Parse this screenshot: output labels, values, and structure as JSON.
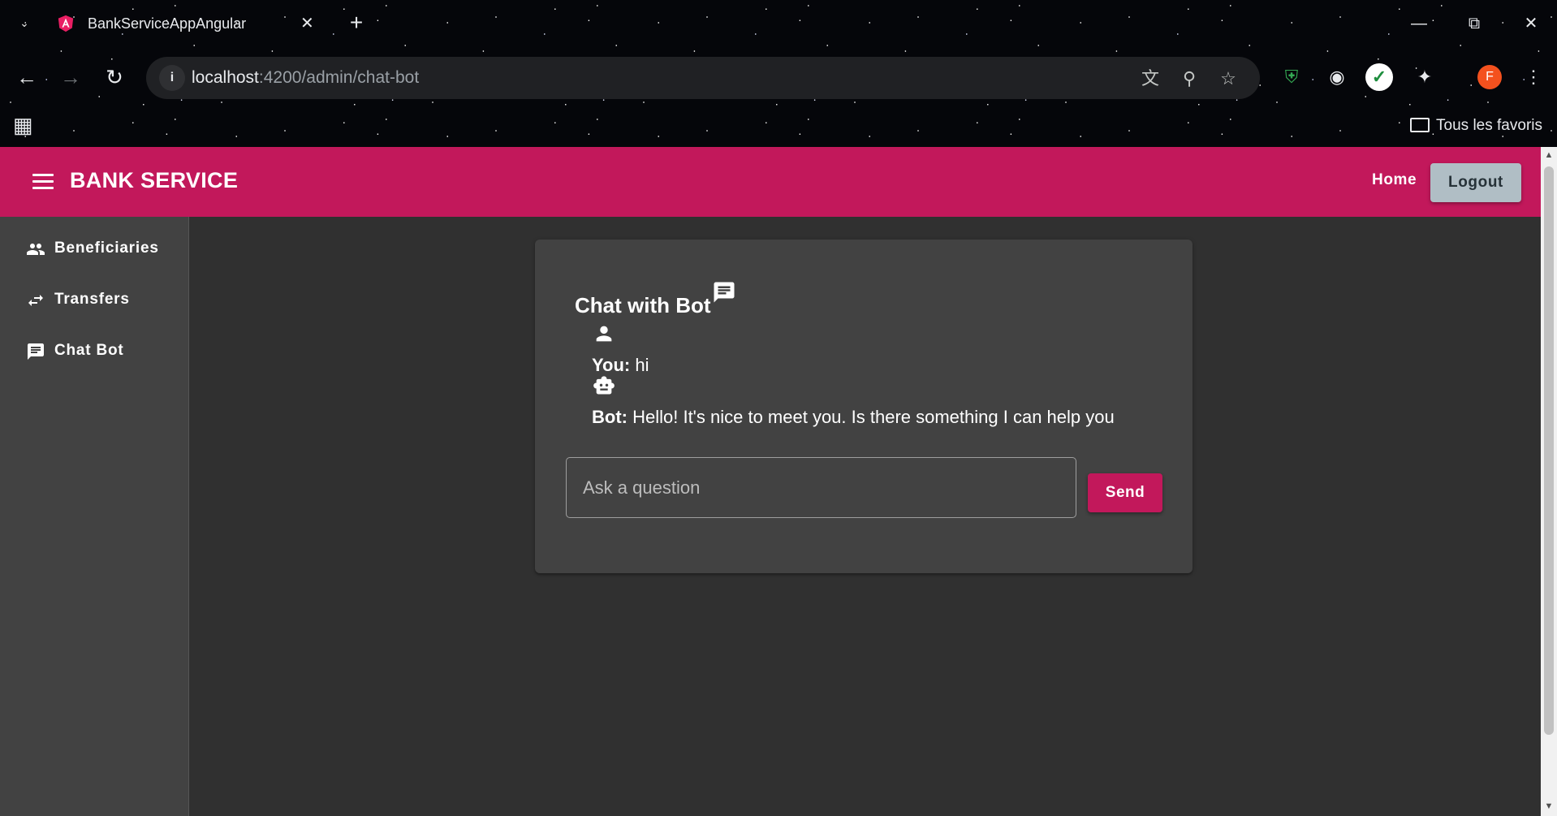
{
  "browser": {
    "tab_title": "BankServiceAppAngular",
    "url_host": "localhost",
    "url_path": ":4200/admin/chat-bot",
    "bookmarks_folder": "Tous les favoris",
    "profile_initial": "F"
  },
  "app": {
    "brand": "BANK SERVICE",
    "home_label": "Home",
    "logout_label": "Logout",
    "accent_color": "#c2185b"
  },
  "sidebar": {
    "items": [
      {
        "label": "Beneficiaries",
        "icon": "people-icon"
      },
      {
        "label": "Transfers",
        "icon": "swap-arrows-icon"
      },
      {
        "label": "Chat Bot",
        "icon": "chat-icon"
      }
    ]
  },
  "chat": {
    "title": "Chat with Bot",
    "messages": [
      {
        "sender": "You:",
        "text": " hi",
        "icon": "person-icon"
      },
      {
        "sender": "Bot:",
        "text": " Hello! It's nice to meet you. Is there something I can help you",
        "icon": "robot-icon"
      }
    ],
    "input_placeholder": "Ask a question",
    "send_label": "Send"
  }
}
